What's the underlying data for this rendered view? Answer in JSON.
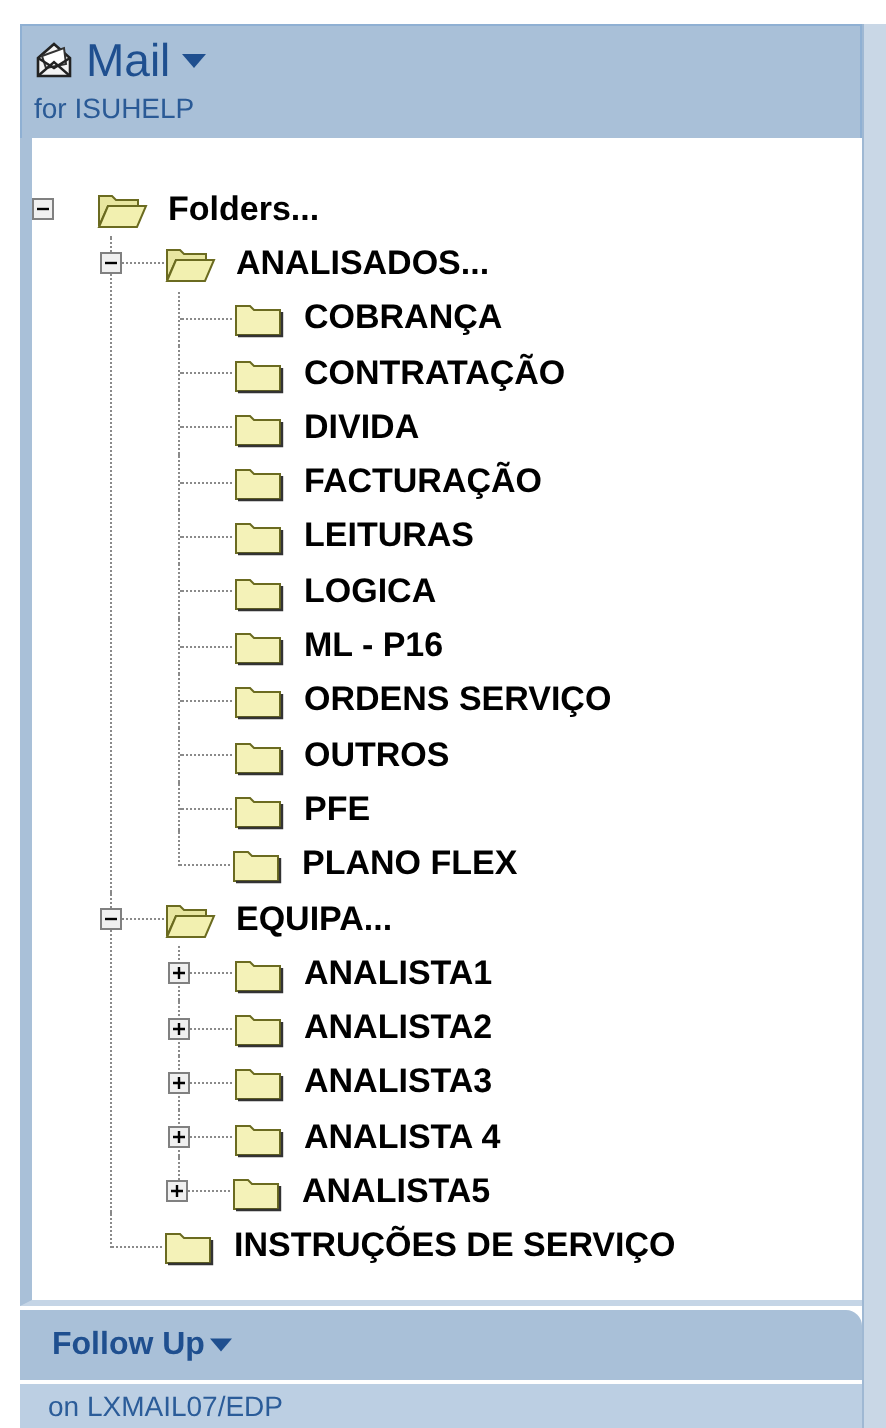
{
  "header": {
    "title": "Mail",
    "subtitle": "for ISUHELP"
  },
  "tree": [
    {
      "label": "Folders...",
      "expanded": true,
      "children": [
        {
          "label": "ANALISADOS...",
          "expanded": true,
          "children": [
            {
              "label": "COBRANÇA"
            },
            {
              "label": "CONTRATAÇÃO"
            },
            {
              "label": "DIVIDA"
            },
            {
              "label": "FACTURAÇÃO"
            },
            {
              "label": "LEITURAS"
            },
            {
              "label": "LOGICA"
            },
            {
              "label": "ML - P16"
            },
            {
              "label": "ORDENS SERVIÇO"
            },
            {
              "label": "OUTROS"
            },
            {
              "label": "PFE"
            },
            {
              "label": "PLANO FLEX"
            }
          ]
        },
        {
          "label": "EQUIPA...",
          "expanded": true,
          "children": [
            {
              "label": "ANALISTA1",
              "expanded": false
            },
            {
              "label": "ANALISTA2",
              "expanded": false
            },
            {
              "label": "ANALISTA3",
              "expanded": false
            },
            {
              "label": "ANALISTA 4",
              "expanded": false
            },
            {
              "label": "ANALISTA5",
              "expanded": false
            }
          ]
        },
        {
          "label": "INSTRUÇÕES DE SERVIÇO"
        }
      ]
    }
  ],
  "footer": {
    "title": "Follow Up"
  },
  "status_bar": "on LXMAIL07/EDP"
}
